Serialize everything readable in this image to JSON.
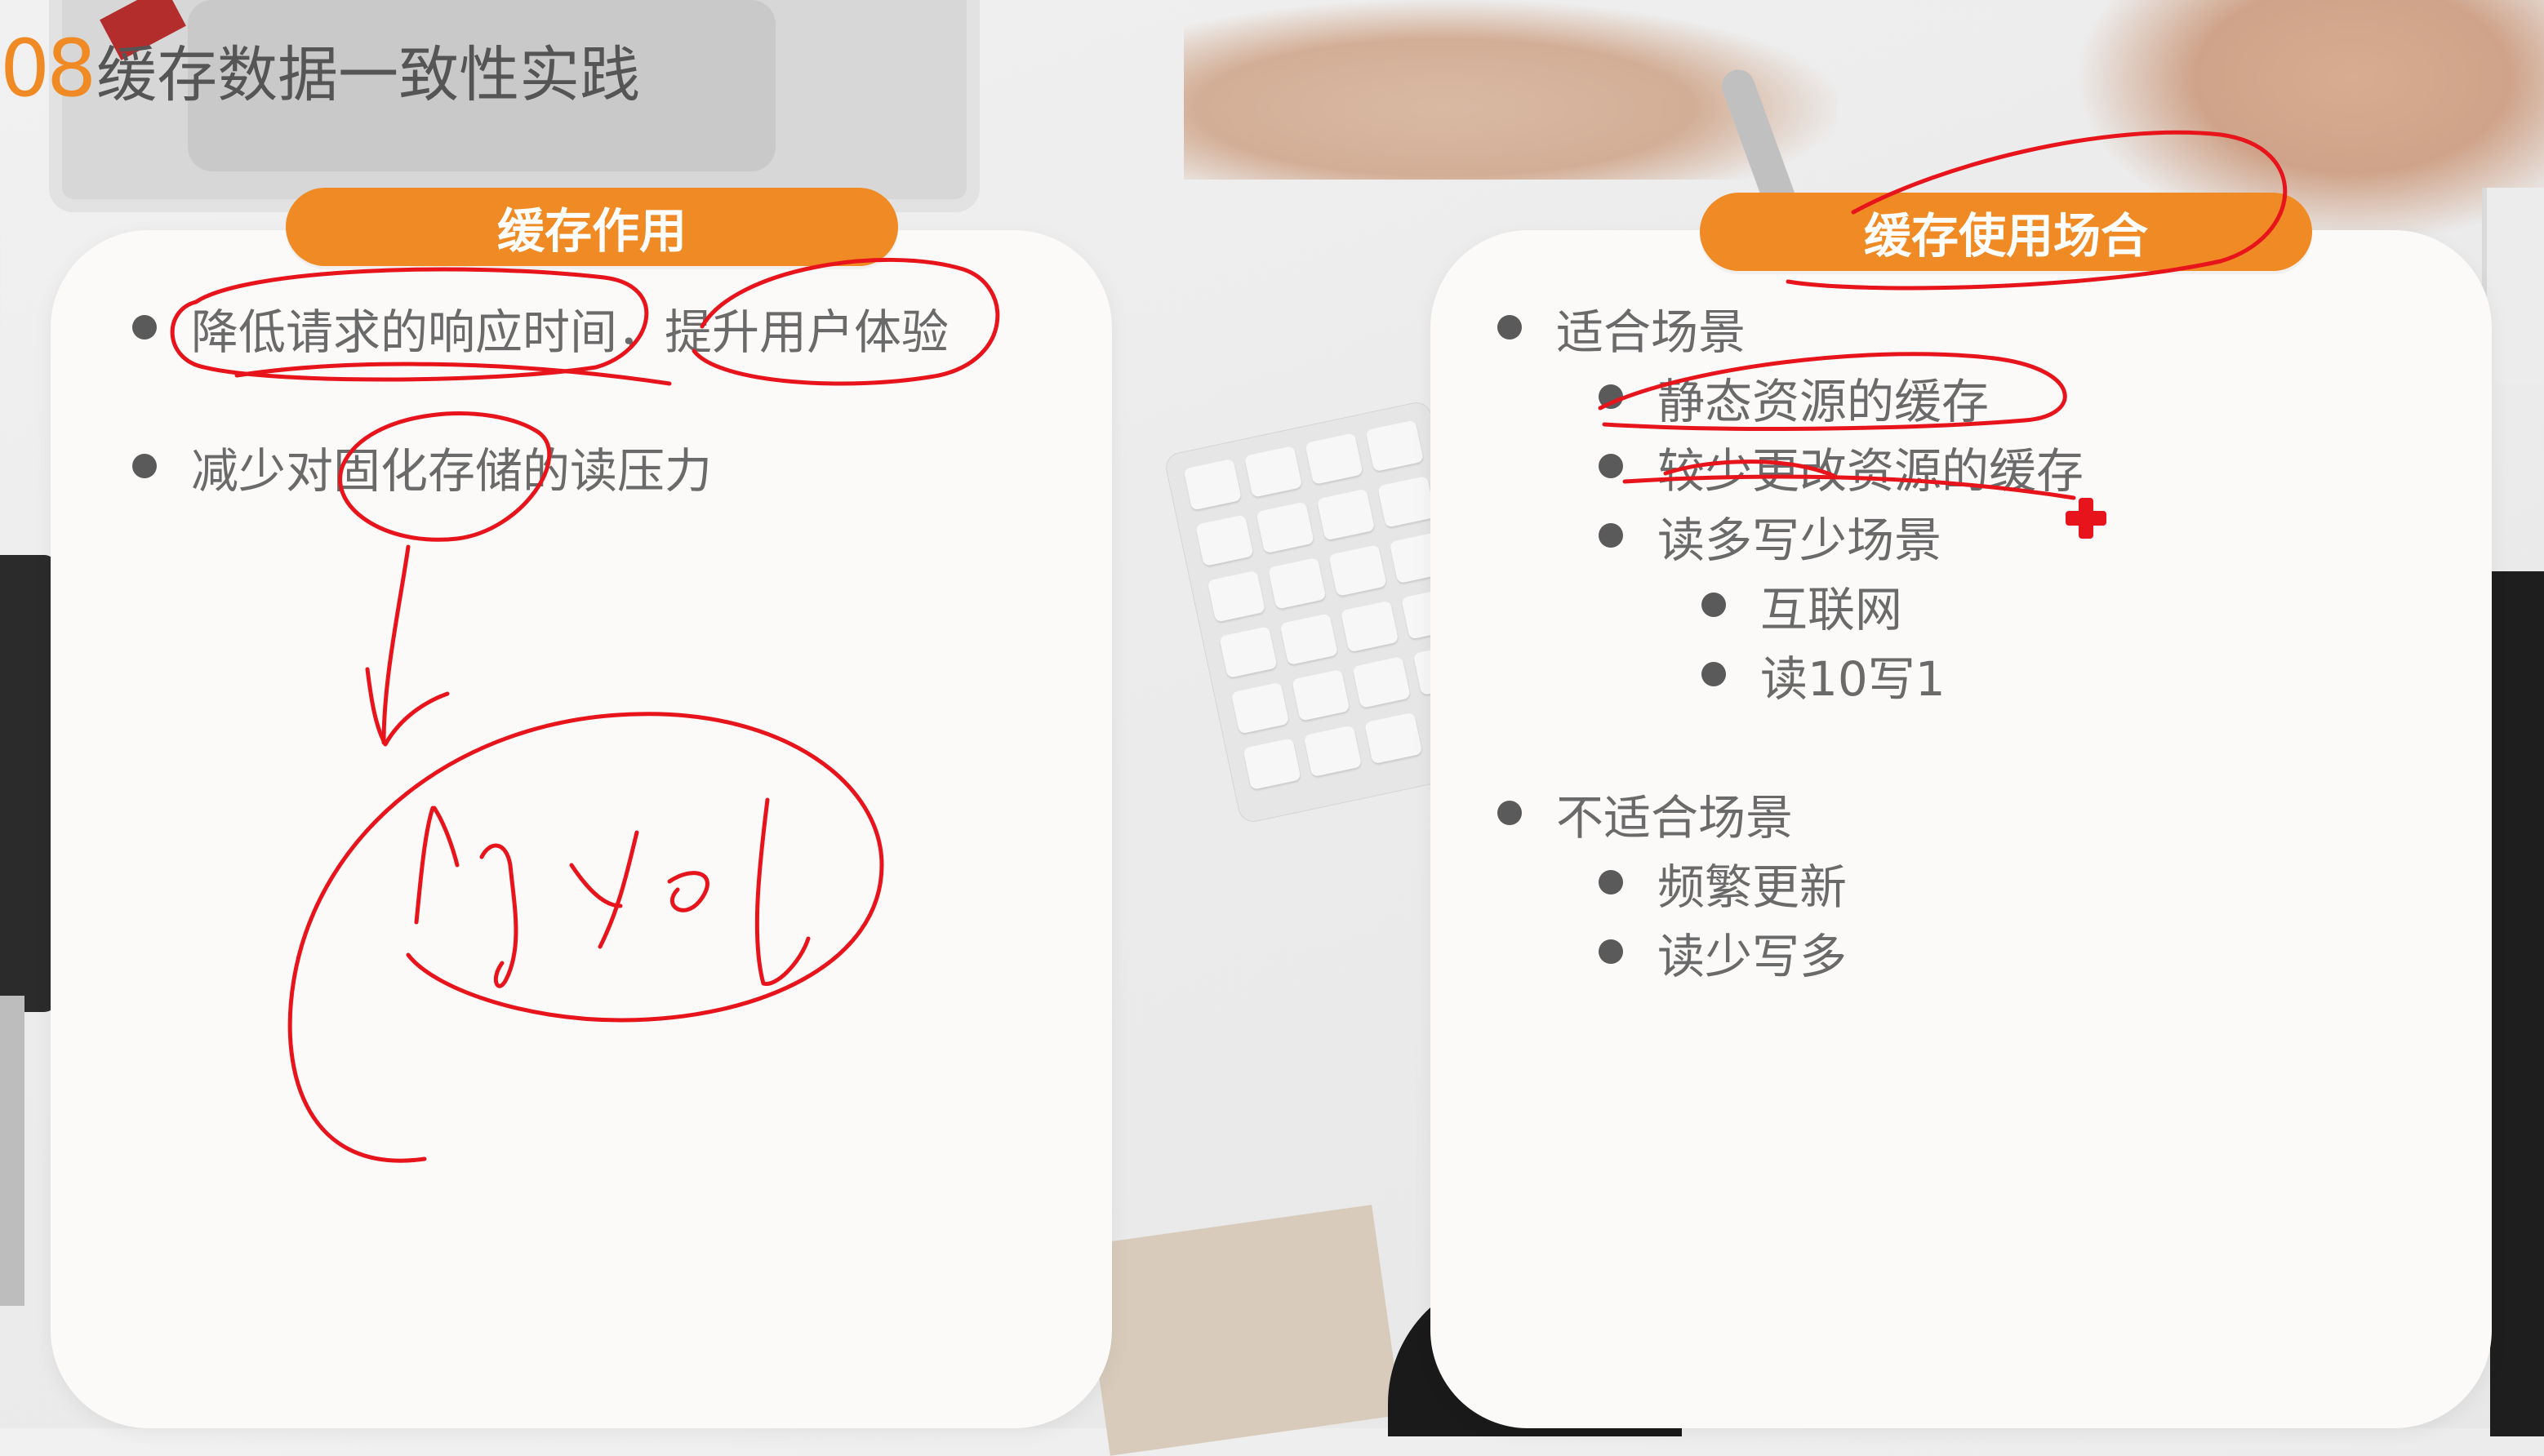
{
  "title": {
    "number": "08",
    "text": "缓存数据一致性实践"
  },
  "left_card": {
    "header": "缓存作用",
    "items": [
      "降低请求的响应时间，提升用户体验",
      "减少对固化存储的读压力"
    ]
  },
  "right_card": {
    "header": "缓存使用场合",
    "items": [
      "适合场景",
      "静态资源的缓存",
      "较少更改资源的缓存",
      "读多写少场景",
      "互联网",
      "读10写1",
      "不适合场景",
      "频繁更新",
      "读少写多"
    ]
  },
  "colors": {
    "accent": "#f08a24",
    "ink": "#e8141c",
    "text": "#6a6a6a"
  },
  "annotation_ink_word": "mysql"
}
